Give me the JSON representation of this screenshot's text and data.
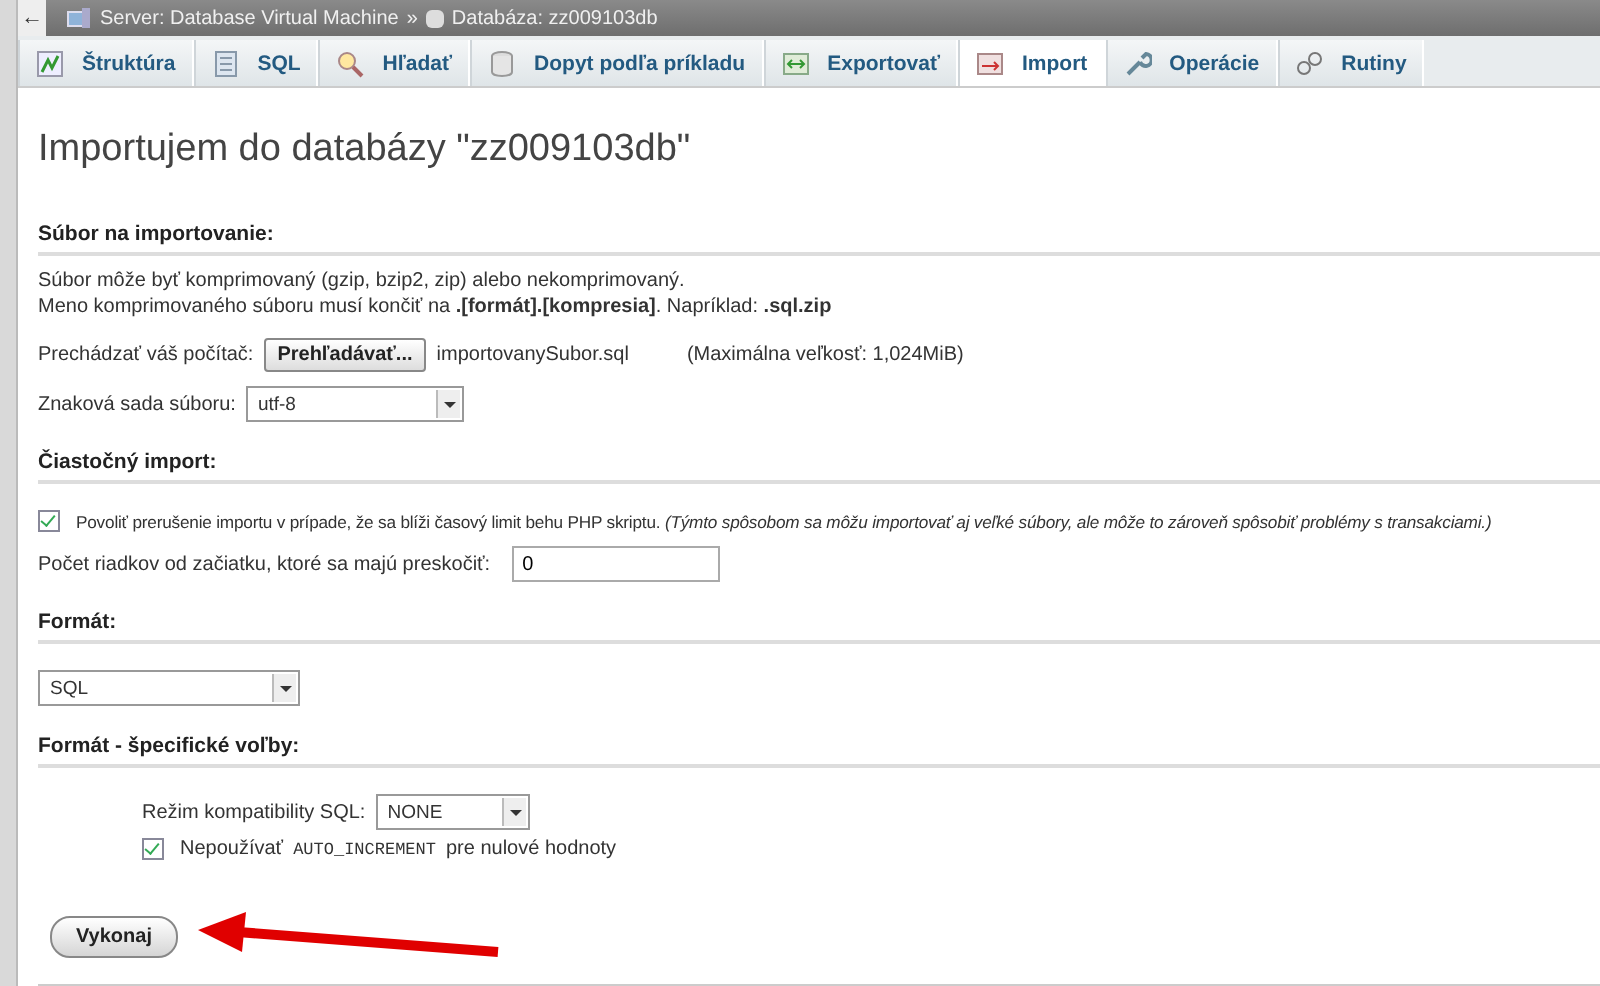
{
  "breadcrumb": {
    "back": "←",
    "server": "Server: Database Virtual Machine",
    "separator": "»",
    "database": "Databáza: zz009103db"
  },
  "tabs": [
    {
      "label": "Štruktúra",
      "kind": "structure",
      "selected": false
    },
    {
      "label": "SQL",
      "kind": "sql",
      "selected": false
    },
    {
      "label": "Hľadať",
      "kind": "search",
      "selected": false
    },
    {
      "label": "Dopyt podľa príkladu",
      "kind": "query",
      "selected": false
    },
    {
      "label": "Exportovať",
      "kind": "export",
      "selected": false
    },
    {
      "label": "Import",
      "kind": "import",
      "selected": true
    },
    {
      "label": "Operácie",
      "kind": "wrench",
      "selected": false
    },
    {
      "label": "Rutiny",
      "kind": "routines",
      "selected": false
    }
  ],
  "title": "Importujem do databázy \"zz009103db\"",
  "file_section": {
    "legend": "Súbor na importovanie:",
    "note_1": "Súbor môže byť komprimovaný (gzip, bzip2, zip) alebo nekomprimovaný.",
    "note_2": "Meno komprimovaného súboru musí končiť na **.[formát].[kompresia]**. Napríklad: **.sql.zip**",
    "browse_label": "Prechádzať váš počítač:",
    "browse_button": "Prehľadávať...",
    "file_name": "importovanySubor.sql",
    "max_size": "(Maximálna veľkosť: 1,024MiB)",
    "charset_label": "Znaková sada súboru:",
    "charset_value": "utf-8"
  },
  "partial_section": {
    "legend": "Čiastočný import:",
    "allow_interrupt": {
      "checked": true,
      "label": "Povoliť prerušenie importu v prípade, že sa blíži časový limit behu PHP skriptu. *(Týmto spôsobom sa môžu importovať aj veľké súbory, ale môže to zároveň spôsobiť problémy s transakciami.)*"
    },
    "skip_label": "Počet riadkov od začiatku, ktoré sa majú preskočiť:",
    "skip_value": "0"
  },
  "format_section": {
    "legend": "Formát:",
    "value": "SQL"
  },
  "options_section": {
    "legend": "Formát - špecifické voľby:",
    "compat_label": "Režim kompatibility SQL:",
    "compat_value": "NONE",
    "no_auto": {
      "checked": true,
      "label_before": "Nepoužívať",
      "code": "AUTO_INCREMENT",
      "label_after": "pre nulové hodnoty"
    }
  },
  "submit": "Vykonaj"
}
